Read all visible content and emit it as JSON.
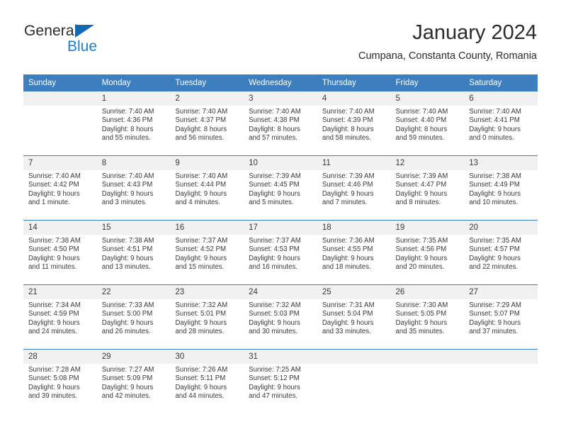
{
  "brand": {
    "line1": "General",
    "line2": "Blue",
    "triangle_color": "#1268b3",
    "blue_text_color": "#1a7fd4"
  },
  "header": {
    "month_title": "January 2024",
    "location": "Cumpana, Constanta County, Romania"
  },
  "theme": {
    "header_blue": "#3d7ebf",
    "daynum_band": "#f1f1f1",
    "text": "#3a3a3a"
  },
  "weekday_headers": [
    "Sunday",
    "Monday",
    "Tuesday",
    "Wednesday",
    "Thursday",
    "Friday",
    "Saturday"
  ],
  "weeks": [
    [
      {
        "empty": true
      },
      {
        "day": "1",
        "sunrise": "Sunrise: 7:40 AM",
        "sunset": "Sunset: 4:36 PM",
        "daylight1": "Daylight: 8 hours",
        "daylight2": "and 55 minutes."
      },
      {
        "day": "2",
        "sunrise": "Sunrise: 7:40 AM",
        "sunset": "Sunset: 4:37 PM",
        "daylight1": "Daylight: 8 hours",
        "daylight2": "and 56 minutes."
      },
      {
        "day": "3",
        "sunrise": "Sunrise: 7:40 AM",
        "sunset": "Sunset: 4:38 PM",
        "daylight1": "Daylight: 8 hours",
        "daylight2": "and 57 minutes."
      },
      {
        "day": "4",
        "sunrise": "Sunrise: 7:40 AM",
        "sunset": "Sunset: 4:39 PM",
        "daylight1": "Daylight: 8 hours",
        "daylight2": "and 58 minutes."
      },
      {
        "day": "5",
        "sunrise": "Sunrise: 7:40 AM",
        "sunset": "Sunset: 4:40 PM",
        "daylight1": "Daylight: 8 hours",
        "daylight2": "and 59 minutes."
      },
      {
        "day": "6",
        "sunrise": "Sunrise: 7:40 AM",
        "sunset": "Sunset: 4:41 PM",
        "daylight1": "Daylight: 9 hours",
        "daylight2": "and 0 minutes."
      }
    ],
    [
      {
        "day": "7",
        "sunrise": "Sunrise: 7:40 AM",
        "sunset": "Sunset: 4:42 PM",
        "daylight1": "Daylight: 9 hours",
        "daylight2": "and 1 minute."
      },
      {
        "day": "8",
        "sunrise": "Sunrise: 7:40 AM",
        "sunset": "Sunset: 4:43 PM",
        "daylight1": "Daylight: 9 hours",
        "daylight2": "and 3 minutes."
      },
      {
        "day": "9",
        "sunrise": "Sunrise: 7:40 AM",
        "sunset": "Sunset: 4:44 PM",
        "daylight1": "Daylight: 9 hours",
        "daylight2": "and 4 minutes."
      },
      {
        "day": "10",
        "sunrise": "Sunrise: 7:39 AM",
        "sunset": "Sunset: 4:45 PM",
        "daylight1": "Daylight: 9 hours",
        "daylight2": "and 5 minutes."
      },
      {
        "day": "11",
        "sunrise": "Sunrise: 7:39 AM",
        "sunset": "Sunset: 4:46 PM",
        "daylight1": "Daylight: 9 hours",
        "daylight2": "and 7 minutes."
      },
      {
        "day": "12",
        "sunrise": "Sunrise: 7:39 AM",
        "sunset": "Sunset: 4:47 PM",
        "daylight1": "Daylight: 9 hours",
        "daylight2": "and 8 minutes."
      },
      {
        "day": "13",
        "sunrise": "Sunrise: 7:38 AM",
        "sunset": "Sunset: 4:49 PM",
        "daylight1": "Daylight: 9 hours",
        "daylight2": "and 10 minutes."
      }
    ],
    [
      {
        "day": "14",
        "sunrise": "Sunrise: 7:38 AM",
        "sunset": "Sunset: 4:50 PM",
        "daylight1": "Daylight: 9 hours",
        "daylight2": "and 11 minutes."
      },
      {
        "day": "15",
        "sunrise": "Sunrise: 7:38 AM",
        "sunset": "Sunset: 4:51 PM",
        "daylight1": "Daylight: 9 hours",
        "daylight2": "and 13 minutes."
      },
      {
        "day": "16",
        "sunrise": "Sunrise: 7:37 AM",
        "sunset": "Sunset: 4:52 PM",
        "daylight1": "Daylight: 9 hours",
        "daylight2": "and 15 minutes."
      },
      {
        "day": "17",
        "sunrise": "Sunrise: 7:37 AM",
        "sunset": "Sunset: 4:53 PM",
        "daylight1": "Daylight: 9 hours",
        "daylight2": "and 16 minutes."
      },
      {
        "day": "18",
        "sunrise": "Sunrise: 7:36 AM",
        "sunset": "Sunset: 4:55 PM",
        "daylight1": "Daylight: 9 hours",
        "daylight2": "and 18 minutes."
      },
      {
        "day": "19",
        "sunrise": "Sunrise: 7:35 AM",
        "sunset": "Sunset: 4:56 PM",
        "daylight1": "Daylight: 9 hours",
        "daylight2": "and 20 minutes."
      },
      {
        "day": "20",
        "sunrise": "Sunrise: 7:35 AM",
        "sunset": "Sunset: 4:57 PM",
        "daylight1": "Daylight: 9 hours",
        "daylight2": "and 22 minutes."
      }
    ],
    [
      {
        "day": "21",
        "sunrise": "Sunrise: 7:34 AM",
        "sunset": "Sunset: 4:59 PM",
        "daylight1": "Daylight: 9 hours",
        "daylight2": "and 24 minutes."
      },
      {
        "day": "22",
        "sunrise": "Sunrise: 7:33 AM",
        "sunset": "Sunset: 5:00 PM",
        "daylight1": "Daylight: 9 hours",
        "daylight2": "and 26 minutes."
      },
      {
        "day": "23",
        "sunrise": "Sunrise: 7:32 AM",
        "sunset": "Sunset: 5:01 PM",
        "daylight1": "Daylight: 9 hours",
        "daylight2": "and 28 minutes."
      },
      {
        "day": "24",
        "sunrise": "Sunrise: 7:32 AM",
        "sunset": "Sunset: 5:03 PM",
        "daylight1": "Daylight: 9 hours",
        "daylight2": "and 30 minutes."
      },
      {
        "day": "25",
        "sunrise": "Sunrise: 7:31 AM",
        "sunset": "Sunset: 5:04 PM",
        "daylight1": "Daylight: 9 hours",
        "daylight2": "and 33 minutes."
      },
      {
        "day": "26",
        "sunrise": "Sunrise: 7:30 AM",
        "sunset": "Sunset: 5:05 PM",
        "daylight1": "Daylight: 9 hours",
        "daylight2": "and 35 minutes."
      },
      {
        "day": "27",
        "sunrise": "Sunrise: 7:29 AM",
        "sunset": "Sunset: 5:07 PM",
        "daylight1": "Daylight: 9 hours",
        "daylight2": "and 37 minutes."
      }
    ],
    [
      {
        "day": "28",
        "sunrise": "Sunrise: 7:28 AM",
        "sunset": "Sunset: 5:08 PM",
        "daylight1": "Daylight: 9 hours",
        "daylight2": "and 39 minutes."
      },
      {
        "day": "29",
        "sunrise": "Sunrise: 7:27 AM",
        "sunset": "Sunset: 5:09 PM",
        "daylight1": "Daylight: 9 hours",
        "daylight2": "and 42 minutes."
      },
      {
        "day": "30",
        "sunrise": "Sunrise: 7:26 AM",
        "sunset": "Sunset: 5:11 PM",
        "daylight1": "Daylight: 9 hours",
        "daylight2": "and 44 minutes."
      },
      {
        "day": "31",
        "sunrise": "Sunrise: 7:25 AM",
        "sunset": "Sunset: 5:12 PM",
        "daylight1": "Daylight: 9 hours",
        "daylight2": "and 47 minutes."
      },
      {
        "empty": true
      },
      {
        "empty": true
      },
      {
        "empty": true
      }
    ]
  ]
}
